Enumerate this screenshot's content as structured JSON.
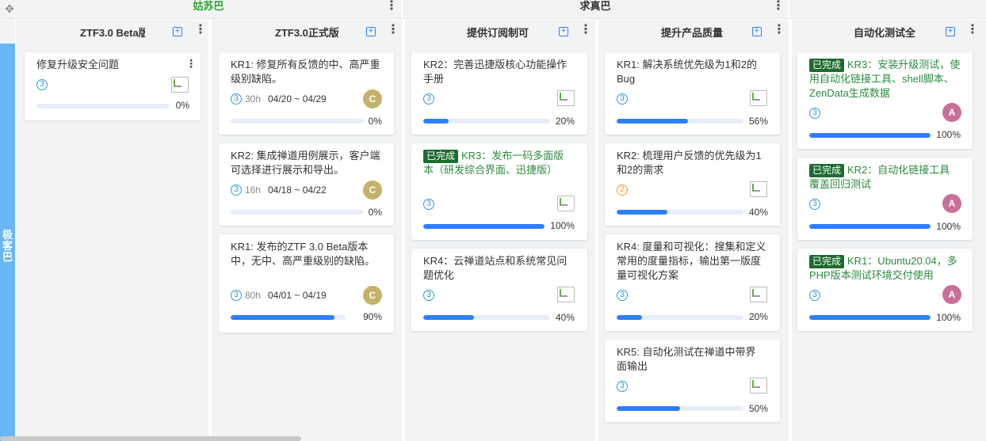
{
  "groups": [
    {
      "title": "姑苏巴",
      "color": "#2fa52f"
    },
    {
      "title": "求真巴",
      "color": "#333333"
    },
    {
      "title": "",
      "color": "#333333"
    }
  ],
  "lane": {
    "title": "极客巴"
  },
  "columns": [
    {
      "title": "ZTF3.0 Beta版",
      "add_label": "+"
    },
    {
      "title": "ZTF3.0正式版",
      "add_label": "+"
    },
    {
      "title": "提供订阅制可",
      "add_label": "+"
    },
    {
      "title": "提升产品质量",
      "add_label": "+"
    },
    {
      "title": "自动化测试全",
      "add_label": "+"
    }
  ],
  "cards": {
    "c1": {
      "title": "修复升级安全问题",
      "priority": "3",
      "progress": 0,
      "pct": "0%"
    },
    "c2": {
      "title": "KR1: 修复所有反馈的中、高严重级别缺陷。",
      "priority": "3",
      "hours": "30h",
      "dates": "04/20 ~ 04/29",
      "avatar": "C",
      "progress": 0,
      "pct": "0%"
    },
    "c3": {
      "title": "KR2: 集成禅道用例展示，客户端可选择进行展示和导出。",
      "priority": "3",
      "hours": "16h",
      "dates": "04/18 ~ 04/22",
      "avatar": "C",
      "progress": 0,
      "pct": "0%"
    },
    "c4": {
      "title": "KR1: 发布的ZTF 3.0 Beta版本中，无中、高严重级别的缺陷。",
      "priority": "3",
      "hours": "80h",
      "dates": "04/01 ~ 04/19",
      "avatar": "C",
      "progress": 90,
      "pct": "90%"
    },
    "c5": {
      "title": "KR2：完善迅捷版核心功能操作手册",
      "priority": "3",
      "progress": 20,
      "pct": "20%"
    },
    "c6": {
      "tag": "已完成",
      "title": "KR3：发布一码多面版本（研发综合界面、迅捷版）",
      "priority": "3",
      "progress": 100,
      "pct": "100%"
    },
    "c7": {
      "title": "KR4：云禅道站点和系统常见问题优化",
      "priority": "3",
      "progress": 40,
      "pct": "40%"
    },
    "c8": {
      "title": "KR1: 解决系统优先级为1和2的Bug",
      "priority": "3",
      "progress": 56,
      "pct": "56%"
    },
    "c9": {
      "title": "KR2: 梳理用户反馈的优先级为1和2的需求",
      "priority": "2",
      "progress": 40,
      "pct": "40%"
    },
    "c10": {
      "title": "KR4: 度量和可视化：搜集和定义常用的度量指标，输出第一版度量可视化方案",
      "priority": "3",
      "progress": 20,
      "pct": "20%"
    },
    "c11": {
      "title": "KR5: 自动化测试在禅道中带界面输出",
      "priority": "3",
      "progress": 50,
      "pct": "50%"
    },
    "c12": {
      "tag": "已完成",
      "title": "KR3：安装升级测试，使用自动化链接工具、shell脚本、ZenData生成数据",
      "priority": "3",
      "avatar": "A",
      "progress": 100,
      "pct": "100%"
    },
    "c13": {
      "tag": "已完成",
      "title": "KR2：自动化链接工具覆盖回归测试",
      "priority": "3",
      "avatar": "A",
      "progress": 100,
      "pct": "100%"
    },
    "c14": {
      "tag": "已完成",
      "title": "KR1：Ubuntu20.04，多PHP版本测试环境交付使用",
      "priority": "3",
      "avatar": "A",
      "progress": 100,
      "pct": "100%"
    }
  },
  "icons": {
    "move": "move-icon",
    "more": "more-vertical-icon",
    "add": "add-square-icon",
    "image": "broken-image-icon"
  }
}
